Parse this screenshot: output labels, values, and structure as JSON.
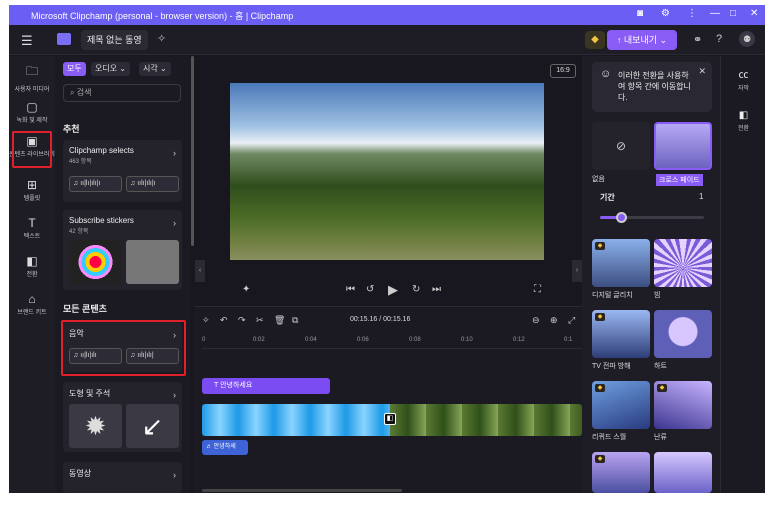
{
  "window": {
    "title": "Microsoft Clipchamp (personal - browser version) - 홈 | Clipchamp"
  },
  "header": {
    "project_title": "제목 없는 동영",
    "export_label": "↑ 내보내기 ⌄",
    "menu_icon": "hamburger-icon"
  },
  "left_nav": [
    {
      "label": "사용자 미디어",
      "icon": "folder-icon"
    },
    {
      "label": "녹화 및 제작",
      "icon": "camera-icon"
    },
    {
      "label": "콘텐츠 라이브러리",
      "icon": "library-icon"
    },
    {
      "label": "템플릿",
      "icon": "grid-icon"
    },
    {
      "label": "텍스트",
      "icon": "text-icon"
    },
    {
      "label": "전환",
      "icon": "transition-icon"
    },
    {
      "label": "브랜드 키트",
      "icon": "brand-icon"
    }
  ],
  "library": {
    "filters": [
      "모두",
      "오디오 ⌄",
      "시각 ⌄"
    ],
    "search_placeholder": "검색",
    "recommend_heading": "추천",
    "cards": [
      {
        "title": "Clipchamp selects",
        "subtitle": "463 항목"
      },
      {
        "title": "Subscribe stickers",
        "subtitle": "42 항목"
      }
    ],
    "all_content_heading": "모든 콘텐츠",
    "categories": [
      {
        "title": "음악"
      },
      {
        "title": "도형 및 주석"
      },
      {
        "title": "동영상"
      }
    ]
  },
  "preview": {
    "aspect_ratio": "16:9"
  },
  "timeline": {
    "time_display": "00:15.16 / 00:15.16",
    "ruler": [
      "0",
      "0:02",
      "0:04",
      "0:06",
      "0:08",
      "0:10",
      "0:12",
      "0:1"
    ],
    "text_clip_label": "안녕하세요",
    "audio_clip_label": "안녕하세"
  },
  "transitions": {
    "tip_text": "이러한 전환을 사용하여 항목 간에 이동합니다.",
    "none_label": "없음",
    "selected_label": "크로스 페이드",
    "duration_label": "기간",
    "duration_value": "1",
    "duration_fraction": 0.2,
    "items": [
      "디지털 글리치",
      "빔",
      "TV 전파 방해",
      "하트",
      "리퀴드 스월",
      "난류"
    ]
  },
  "right_rail": [
    {
      "label": "자막",
      "icon": "captions-icon"
    },
    {
      "label": "전환",
      "icon": "transition-icon"
    }
  ],
  "colors": {
    "accent": "#8a5cf6",
    "title_bar": "#6b5ef3",
    "highlight": "#e0202c"
  }
}
